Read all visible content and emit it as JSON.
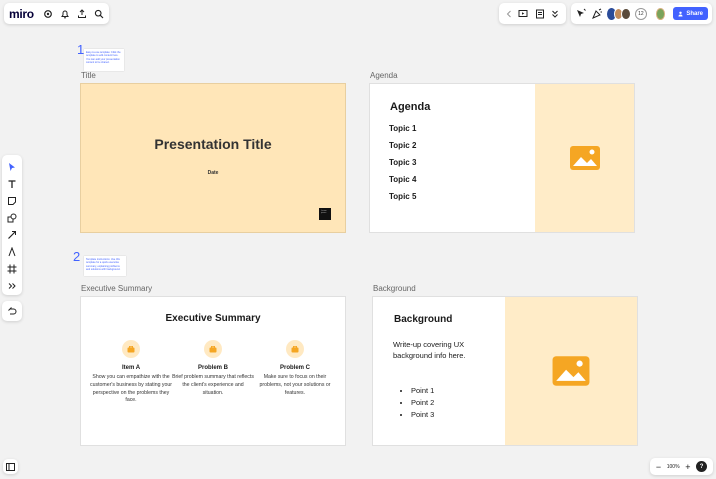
{
  "app": {
    "logo": "miro"
  },
  "topbar": {
    "collaborator_count": "12",
    "share_label": "Share"
  },
  "zoom": {
    "level": "100%",
    "help": "?"
  },
  "frames": [
    {
      "number": "1",
      "sticky_text": "Easy-to-use template: Click the template to edit content here. You can add your presentation content to be shared.",
      "left_label": "Title",
      "right_label": "Agenda"
    },
    {
      "number": "2",
      "sticky_text": "Template instructions: Use this template for a quick executive summary, explaining problems and solutions with background.",
      "left_label": "Executive Summary",
      "right_label": "Background"
    }
  ],
  "slide_title": {
    "title": "Presentation Title",
    "date": "Date",
    "mini_note": "Lorem ipsum"
  },
  "slide_agenda": {
    "heading": "Agenda",
    "topics": [
      "Topic 1",
      "Topic 2",
      "Topic 3",
      "Topic 4",
      "Topic 5"
    ]
  },
  "slide_exec": {
    "heading": "Executive Summary",
    "columns": [
      {
        "title": "Item A",
        "body": "Show you can empathize with the customer's business by stating your perspective on the problems they face."
      },
      {
        "title": "Problem B",
        "body": "Brief problem summary that reflects the client's experience and situation."
      },
      {
        "title": "Problem C",
        "body": "Make sure to focus on their problems, not your solutions or features."
      }
    ]
  },
  "slide_background": {
    "heading": "Background",
    "description": "Write-up covering UX background info here.",
    "points": [
      "Point 1",
      "Point 2",
      "Point 3"
    ]
  },
  "colors": {
    "accent": "#4262ff",
    "slide_peach": "#ffe6b8",
    "image_placeholder": "#f5a623"
  }
}
